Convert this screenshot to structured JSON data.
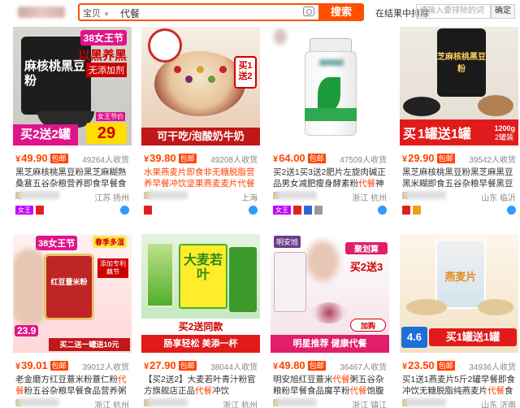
{
  "search": {
    "category": "宝贝",
    "query": "代餐",
    "button": "搜索",
    "exclude_label": "在结果中排除",
    "exclude_placeholder": "请输入要排除的词",
    "exclude_button": "确定"
  },
  "products": [
    {
      "price": "49.90",
      "baoyou": "包邮",
      "sales": "49264人收货",
      "title_parts": [
        {
          "t": "黑芝麻核桃黑豆粉黑芝麻糊熟桑葚五谷杂粮营养即食早餐食品",
          "h": false
        },
        {
          "t": "代餐",
          "h": true
        },
        {
          "t": "粉",
          "h": false
        }
      ],
      "location": "江苏 扬州",
      "art": {
        "tag": "38女王节",
        "head": "以黑养黑",
        "sub": "无添加剂",
        "label": "麻核桃黑豆粉",
        "promo": "买2送2罐",
        "num": "29",
        "numlabel": "女王节价"
      },
      "badges": [
        "tm",
        "red"
      ]
    },
    {
      "price": "39.80",
      "baoyou": "包邮",
      "sales": "49208人收货",
      "title_parts": [
        {
          "t": "水果燕麦片即食非无糖脱脂营养早餐冲饮坚果燕麦麦片代餐食品饱腹",
          "h": true
        }
      ],
      "location": "上海",
      "art": {
        "label": "可干吃/泡酸奶牛奶",
        "promo": "买1送2"
      },
      "badges": [
        "red"
      ]
    },
    {
      "price": "64.00",
      "baoyou": "包邮",
      "sales": "47509人收货",
      "title_parts": [
        {
          "t": "买2送1买3送2",
          "h": false
        },
        {
          "t": "肥片左旋肉碱正品男女减肥瘦身酵素粉",
          "h": false
        },
        {
          "t": "代餐",
          "h": true
        },
        {
          "t": "神器",
          "h": false
        }
      ],
      "location": "浙江 杭州",
      "art": {},
      "badges": [
        "tm",
        "red",
        "blue",
        "gray"
      ]
    },
    {
      "price": "29.90",
      "baoyou": "包邮",
      "sales": "39542人收货",
      "title_parts": [
        {
          "t": "黑芝麻核桃黑豆粉黑芝麻黑豆黑米糊即食五谷杂粮早餐黑豆粉 现磨熟黑芝麻糊即食三黑营养",
          "h": false
        },
        {
          "t": "代餐",
          "h": true
        },
        {
          "t": "粉",
          "h": false
        }
      ],
      "location": "山东 临沂",
      "art": {
        "label": "芝麻核桃黑豆粉",
        "promo1": "买",
        "promo2": "1罐送1罐",
        "weight": "1200g",
        "cans": "2罐装"
      },
      "badges": [
        "red",
        "gold"
      ]
    },
    {
      "price": "39.01",
      "baoyou": "包邮",
      "sales": "39012人收货",
      "title_parts": [
        {
          "t": "老金磨方红豆薏米粉薏仁粉",
          "h": false
        },
        {
          "t": "代餐",
          "h": true
        },
        {
          "t": "粉五谷杂粮早餐食品营养粥懒人冲饮",
          "h": false
        }
      ],
      "location": "浙江 杭州",
      "art": {
        "tag": "38女王节",
        "tag2": "春季多湿",
        "sub": "添加专利藕节",
        "label": "红豆薏米粉",
        "price_tag": "23.9",
        "promo": "买二送一罐送10元"
      },
      "badges": [
        "red",
        "gray"
      ]
    },
    {
      "price": "27.90",
      "baoyou": "包邮",
      "sales": "38044人收货",
      "title_parts": [
        {
          "t": "【买2送2】大麦若叶青汁粉官方旗舰店正品",
          "h": false
        },
        {
          "t": "代餐",
          "h": true
        },
        {
          "t": "冲饮",
          "h": false
        }
      ],
      "location": "浙江 杭州",
      "art": {
        "label": "大麦若叶",
        "promo": "买2送同款",
        "sub": "肠享轻松 美添一杯"
      },
      "badges": [
        "red",
        "gray"
      ]
    },
    {
      "price": "49.80",
      "baoyou": "包邮",
      "sales": "36467人收货",
      "title_parts": [
        {
          "t": "明安旭红豆薏米",
          "h": false
        },
        {
          "t": "代餐",
          "h": true
        },
        {
          "t": "粥五谷杂粮粉早餐食品魔芋粉",
          "h": false
        },
        {
          "t": "代餐",
          "h": true
        },
        {
          "t": "饱腹",
          "h": false
        }
      ],
      "location": "浙江 镇江",
      "art": {
        "brand": "明安旭",
        "promo": "买2送3",
        "sub": "聚划算",
        "label": "明星推荐 健康代餐",
        "add": "加购"
      },
      "badges": [
        "red",
        "gray"
      ]
    },
    {
      "price": "23.50",
      "baoyou": "包邮",
      "sales": "34936人收货",
      "title_parts": [
        {
          "t": "买1送1燕麦片5斤2罐早餐即食冲饮无糖脱脂纯燕麦片",
          "h": false
        },
        {
          "t": "代餐",
          "h": true
        },
        {
          "t": "食品",
          "h": false
        }
      ],
      "location": "山东 济南",
      "art": {
        "label": "燕麦片",
        "promo": "买1罐送1罐",
        "price_tag": "4.6"
      },
      "badges": [
        "red",
        "gray"
      ]
    }
  ]
}
